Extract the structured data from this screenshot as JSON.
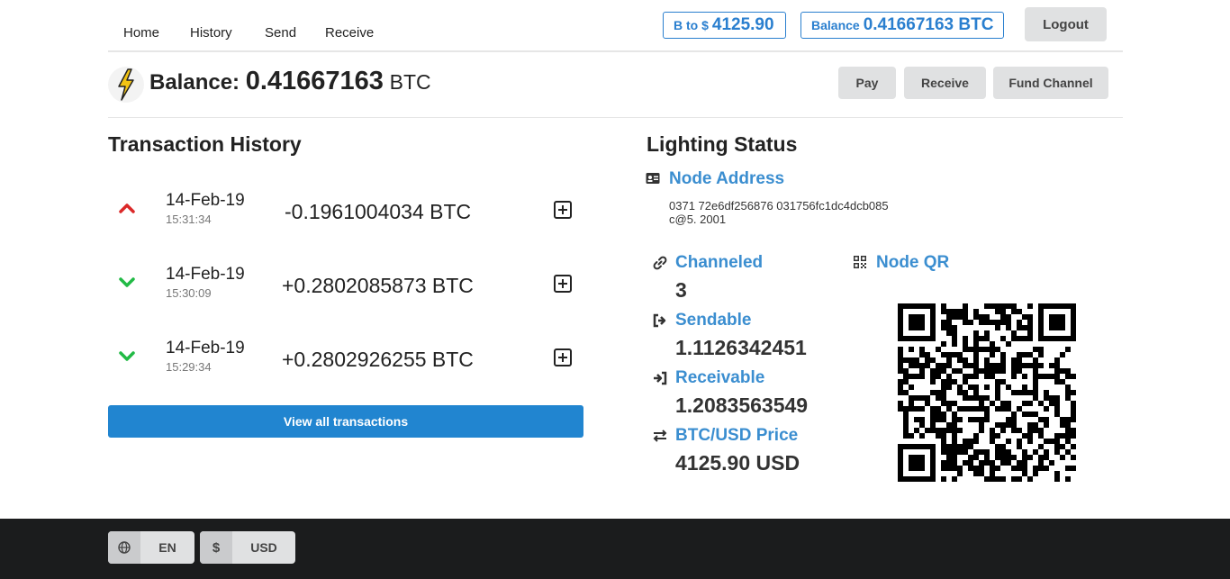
{
  "nav": {
    "links": [
      "Home",
      "History",
      "Send",
      "Receive"
    ],
    "rate_prefix": "B to $",
    "rate_value": "4125.90",
    "balance_prefix": "Balance",
    "balance_value": "0.41667163 BTC",
    "logout_label": "Logout"
  },
  "header": {
    "balance_label": "Balance:",
    "balance_value": "0.41667163",
    "balance_unit": "BTC",
    "pay_label": "Pay",
    "receive_label": "Receive",
    "fund_label": "Fund Channel"
  },
  "transactions": {
    "title": "Transaction History",
    "items": [
      {
        "direction": "out",
        "date": "14-Feb-19",
        "time": "15:31:34",
        "amount": "-0.1961004034 BTC"
      },
      {
        "direction": "in",
        "date": "14-Feb-19",
        "time": "15:30:09",
        "amount": "+0.2802085873 BTC"
      },
      {
        "direction": "in",
        "date": "14-Feb-19",
        "time": "15:29:34",
        "amount": "+0.2802926255 BTC"
      }
    ],
    "view_all_label": "View all transactions"
  },
  "status": {
    "title": "Lighting Status",
    "node_address_label": "Node Address",
    "node_address_line1": "0371  72e6df256876  031756fc1dc4dcb085",
    "node_address_line2": "c@5.  2001",
    "channeled_label": "Channeled",
    "channeled_value": "3",
    "sendable_label": "Sendable",
    "sendable_value": "1.1126342451",
    "receivable_label": "Receivable",
    "receivable_value": "1.2083563549",
    "price_label": "BTC/USD Price",
    "price_value": "4125.90 USD",
    "qr_label": "Node QR"
  },
  "footer": {
    "language_label": "EN",
    "currency_symbol": "$",
    "currency_label": "USD"
  },
  "colors": {
    "accent": "#2185d0",
    "link": "#3b8ed0",
    "out_arrow": "#db2828",
    "in_arrow": "#21ba45",
    "bolt": "#f2c314"
  }
}
